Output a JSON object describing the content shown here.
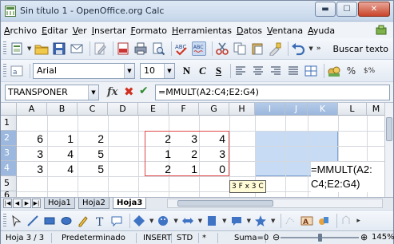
{
  "window": {
    "title": "Sin título 1 - OpenOffice.org Calc",
    "min_label": "▬",
    "max_label": "☐",
    "close_label": "✕"
  },
  "menu": [
    "Archivo",
    "Editar",
    "Ver",
    "Insertar",
    "Formato",
    "Herramientas",
    "Datos",
    "Ventana",
    "Ayuda"
  ],
  "toolbar": {
    "find_label": "Buscar texto",
    "font_name": "Arial",
    "font_size": "10",
    "bold": "N",
    "italic": "C",
    "underline": "S",
    "percent": "%",
    "currency": "$%"
  },
  "formula_bar": {
    "name_box": "TRANSPONER",
    "fx_label": "fx",
    "cancel_label": "✖",
    "accept_label": "✔",
    "content": "=MMULT(A2:C4;E2:G4)"
  },
  "grid": {
    "columns": [
      "A",
      "B",
      "C",
      "D",
      "E",
      "F",
      "G",
      "H",
      "I",
      "J",
      "K",
      "L",
      "M"
    ],
    "rows": [
      "1",
      "2",
      "3",
      "4",
      "5",
      "6"
    ],
    "matrix1": [
      [
        "6",
        "1",
        "2"
      ],
      [
        "3",
        "4",
        "5"
      ],
      [
        "3",
        "4",
        "5"
      ]
    ],
    "matrix2": [
      [
        "2",
        "3",
        "4"
      ],
      [
        "1",
        "2",
        "3"
      ],
      [
        "2",
        "1",
        "0"
      ]
    ],
    "edit_line1": "=MMULT(A2:",
    "edit_line2": "C4;E2:G4)",
    "tooltip": "3 F x 3 C"
  },
  "sheets": {
    "tabs": [
      "Hoja1",
      "Hoja2",
      "Hoja3"
    ],
    "active": "Hoja3"
  },
  "status": {
    "sheet": "Hoja 3 / 3",
    "style": "Predeterminado",
    "mode": "INSERT",
    "selection": "STD",
    "modified": "*",
    "sum": "Suma=0",
    "zoom": "145%"
  },
  "colors": {
    "selection": "#c7dcf4",
    "ref_border": "#e04848",
    "header_selected": "#9cb8de"
  }
}
